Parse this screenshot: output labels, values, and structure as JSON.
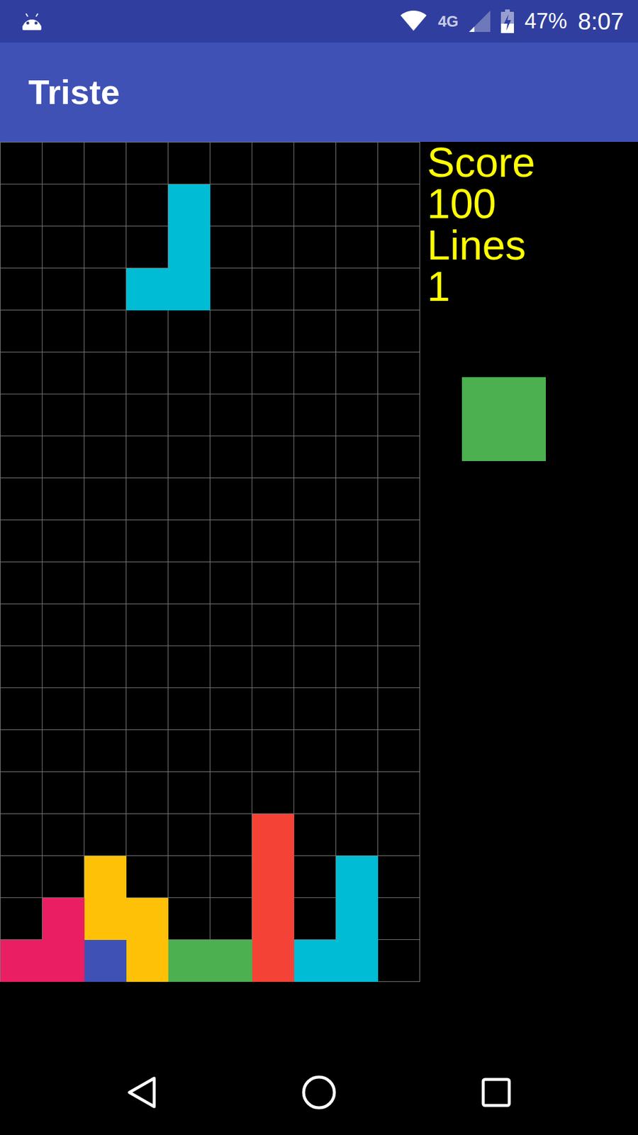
{
  "status_bar": {
    "network": "4G",
    "wifi_level": 1,
    "signal_level": 0.25,
    "battery_level": 0.47,
    "charging": true,
    "battery": "47%",
    "time": "8:07"
  },
  "app_bar": {
    "title": "Triste"
  },
  "board": {
    "rows": [
      [
        null,
        null,
        null,
        null,
        null,
        null,
        null,
        null,
        null,
        null
      ],
      [
        null,
        null,
        null,
        null,
        "#00BCD4",
        null,
        null,
        null,
        null,
        null
      ],
      [
        null,
        null,
        null,
        null,
        "#00BCD4",
        null,
        null,
        null,
        null,
        null
      ],
      [
        null,
        null,
        null,
        "#00BCD4",
        "#00BCD4",
        null,
        null,
        null,
        null,
        null
      ],
      [
        null,
        null,
        null,
        null,
        null,
        null,
        null,
        null,
        null,
        null
      ],
      [
        null,
        null,
        null,
        null,
        null,
        null,
        null,
        null,
        null,
        null
      ],
      [
        null,
        null,
        null,
        null,
        null,
        null,
        null,
        null,
        null,
        null
      ],
      [
        null,
        null,
        null,
        null,
        null,
        null,
        null,
        null,
        null,
        null
      ],
      [
        null,
        null,
        null,
        null,
        null,
        null,
        null,
        null,
        null,
        null
      ],
      [
        null,
        null,
        null,
        null,
        null,
        null,
        null,
        null,
        null,
        null
      ],
      [
        null,
        null,
        null,
        null,
        null,
        null,
        null,
        null,
        null,
        null
      ],
      [
        null,
        null,
        null,
        null,
        null,
        null,
        null,
        null,
        null,
        null
      ],
      [
        null,
        null,
        null,
        null,
        null,
        null,
        null,
        null,
        null,
        null
      ],
      [
        null,
        null,
        null,
        null,
        null,
        null,
        null,
        null,
        null,
        null
      ],
      [
        null,
        null,
        null,
        null,
        null,
        null,
        null,
        null,
        null,
        null
      ],
      [
        null,
        null,
        null,
        null,
        null,
        null,
        null,
        null,
        null,
        null
      ],
      [
        null,
        null,
        null,
        null,
        null,
        null,
        "#F44336",
        null,
        null,
        null
      ],
      [
        null,
        null,
        "#FFC107",
        null,
        null,
        null,
        "#F44336",
        null,
        "#00BCD4",
        null
      ],
      [
        null,
        "#E91E63",
        "#FFC107",
        "#FFC107",
        null,
        null,
        "#F44336",
        null,
        "#00BCD4",
        null
      ],
      [
        "#E91E63",
        "#E91E63",
        "#3F51B5",
        "#FFC107",
        "#4CAF50",
        "#4CAF50",
        "#F44336",
        "#00BCD4",
        "#00BCD4",
        null
      ]
    ]
  },
  "side_panel": {
    "score_label": "Score",
    "score": "100",
    "lines_label": "Lines",
    "lines": "1"
  },
  "next_piece": {
    "rows": [
      [
        "#4CAF50",
        "#4CAF50"
      ],
      [
        "#4CAF50",
        "#4CAF50"
      ]
    ]
  }
}
